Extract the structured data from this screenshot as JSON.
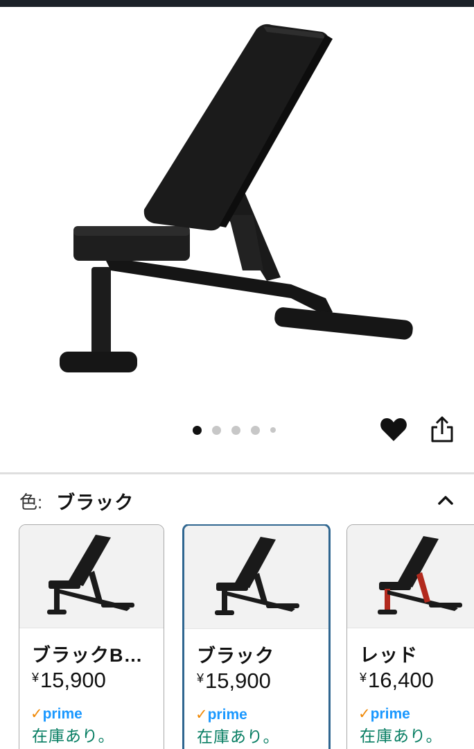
{
  "product": {
    "color_label": "色:",
    "color_value": "ブラック",
    "image_count": 5,
    "active_image_index": 0
  },
  "actions": {
    "wishlist_icon": "heart-icon",
    "share_icon": "share-icon",
    "collapse_icon": "chevron-up-icon"
  },
  "variants": [
    {
      "name": "ブラックB…",
      "currency": "¥",
      "price": "15,900",
      "prime_check": "✓",
      "prime_label": "prime",
      "stock": "在庫あり。",
      "frame_color": "#1a1a1a"
    },
    {
      "name": "ブラック",
      "currency": "¥",
      "price": "15,900",
      "prime_check": "✓",
      "prime_label": "prime",
      "stock": "在庫あり。",
      "frame_color": "#1a1a1a"
    },
    {
      "name": "レッド",
      "currency": "¥",
      "price": "16,400",
      "prime_check": "✓",
      "prime_label": "prime",
      "stock": "在庫あり。",
      "frame_color": "#b22a1e"
    }
  ],
  "colors": {
    "selected_border": "#2f6690",
    "prime_blue": "#1a98ff",
    "prime_check": "#f08804",
    "in_stock": "#067d62"
  }
}
